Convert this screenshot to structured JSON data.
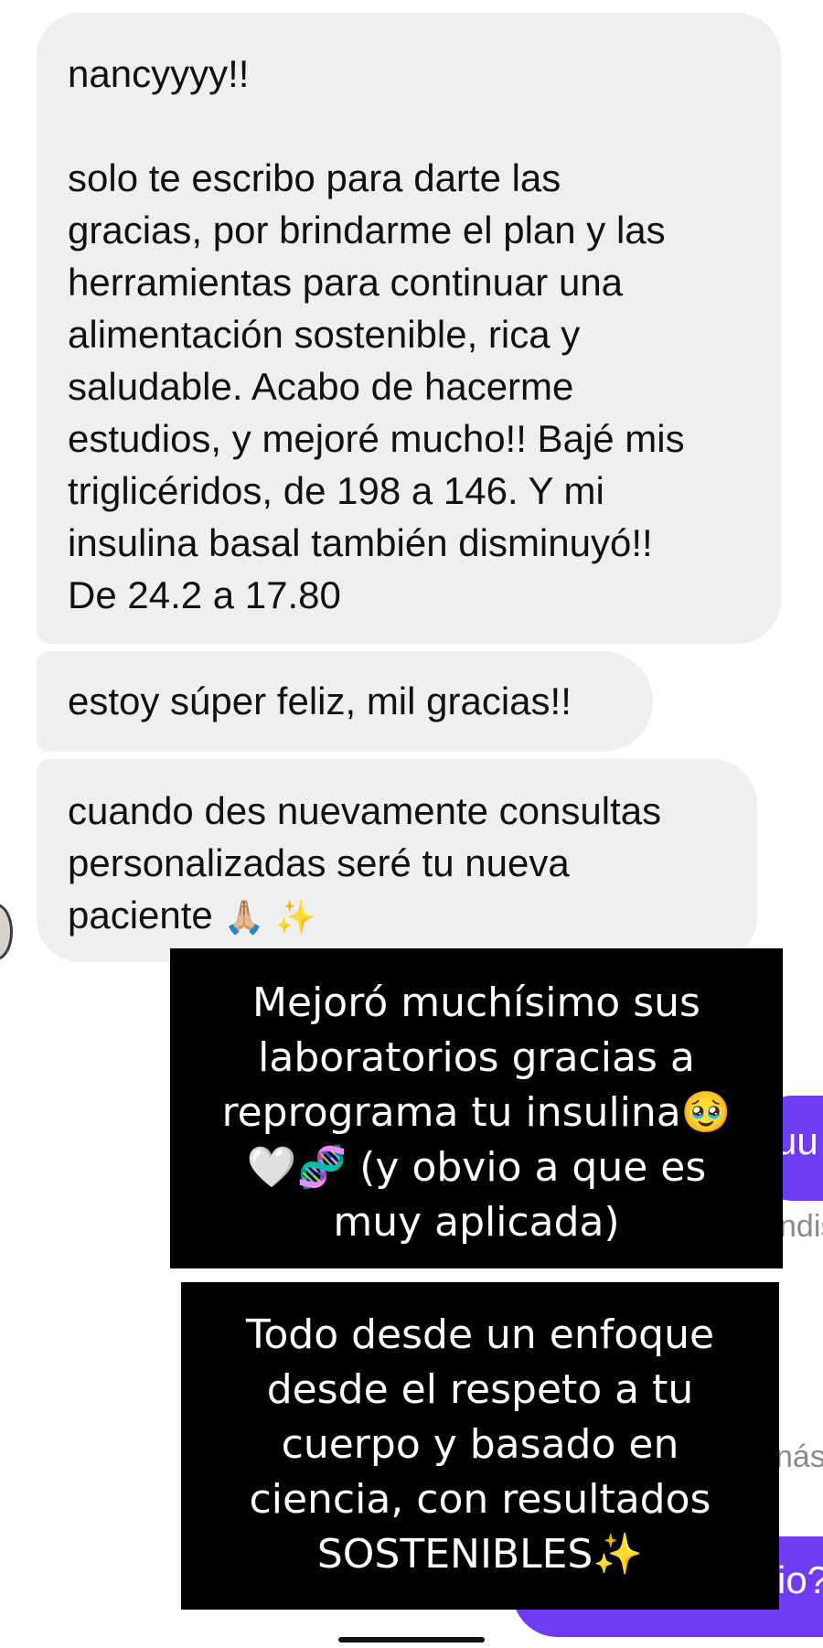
{
  "messages": [
    {
      "text": "nancyyyy!!\n\nsolo te escribo para darte las\ngracias, por brindarme el plan y las\nherramientas para continuar una\nalimentación sostenible, rica y\nsaludable. Acabo de hacerme\nestudios, y mejoré mucho!! Bajé mis\ntriglicéridos, de 198 a 146. Y mi\ninsulina basal también disminuyó!!\nDe 24.2 a 17.80"
    },
    {
      "text": "estoy súper feliz, mil gracias!!"
    },
    {
      "text": "cuando des nuevamente consultas\npersonalizadas seré tu nueva\npaciente ",
      "emoji": "🙏🏼 ✨"
    }
  ],
  "overlays": [
    "Mejoró muchísimo sus\nlaboratorios gracias a\nreprograma tu insulina🥹\n🤍🧬 (y obvio a que es\nmuy aplicada)",
    "Todo desde un enfoque\ndesde el respeto a tu\ncuerpo y basado en\nciencia, con resultados\nSOSTENIBLES✨"
  ],
  "partial_sent": {
    "bubble1": "uu",
    "bubble2": "io?"
  },
  "partial_peek": {
    "line1": "ndis",
    "line2": "nás"
  },
  "colors": {
    "received_bubble": "#efeff1",
    "sent_bubble": "#6f3cf4",
    "overlay_box": "#000000"
  }
}
